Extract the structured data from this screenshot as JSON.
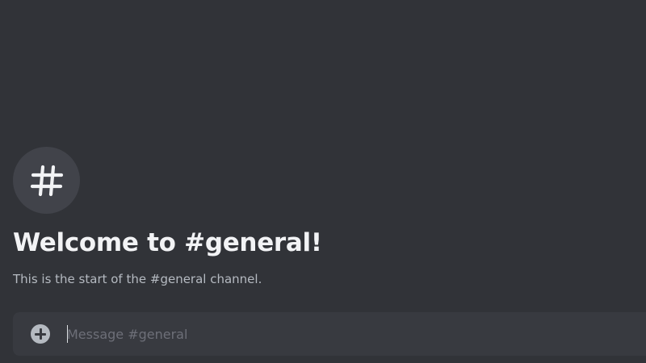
{
  "channel": {
    "icon": "hash-icon",
    "welcome_title": "Welcome to #general!",
    "welcome_subtitle": "This is the start of the #general channel."
  },
  "composer": {
    "attach_icon": "plus-circle-icon",
    "placeholder": "Message #general",
    "value": ""
  },
  "colors": {
    "background": "#313338",
    "icon_circle": "#41434a",
    "composer_background": "#383a40",
    "title_text": "#f2f3f5",
    "muted_text": "#b5bac1",
    "placeholder_text": "#6d6f78"
  }
}
